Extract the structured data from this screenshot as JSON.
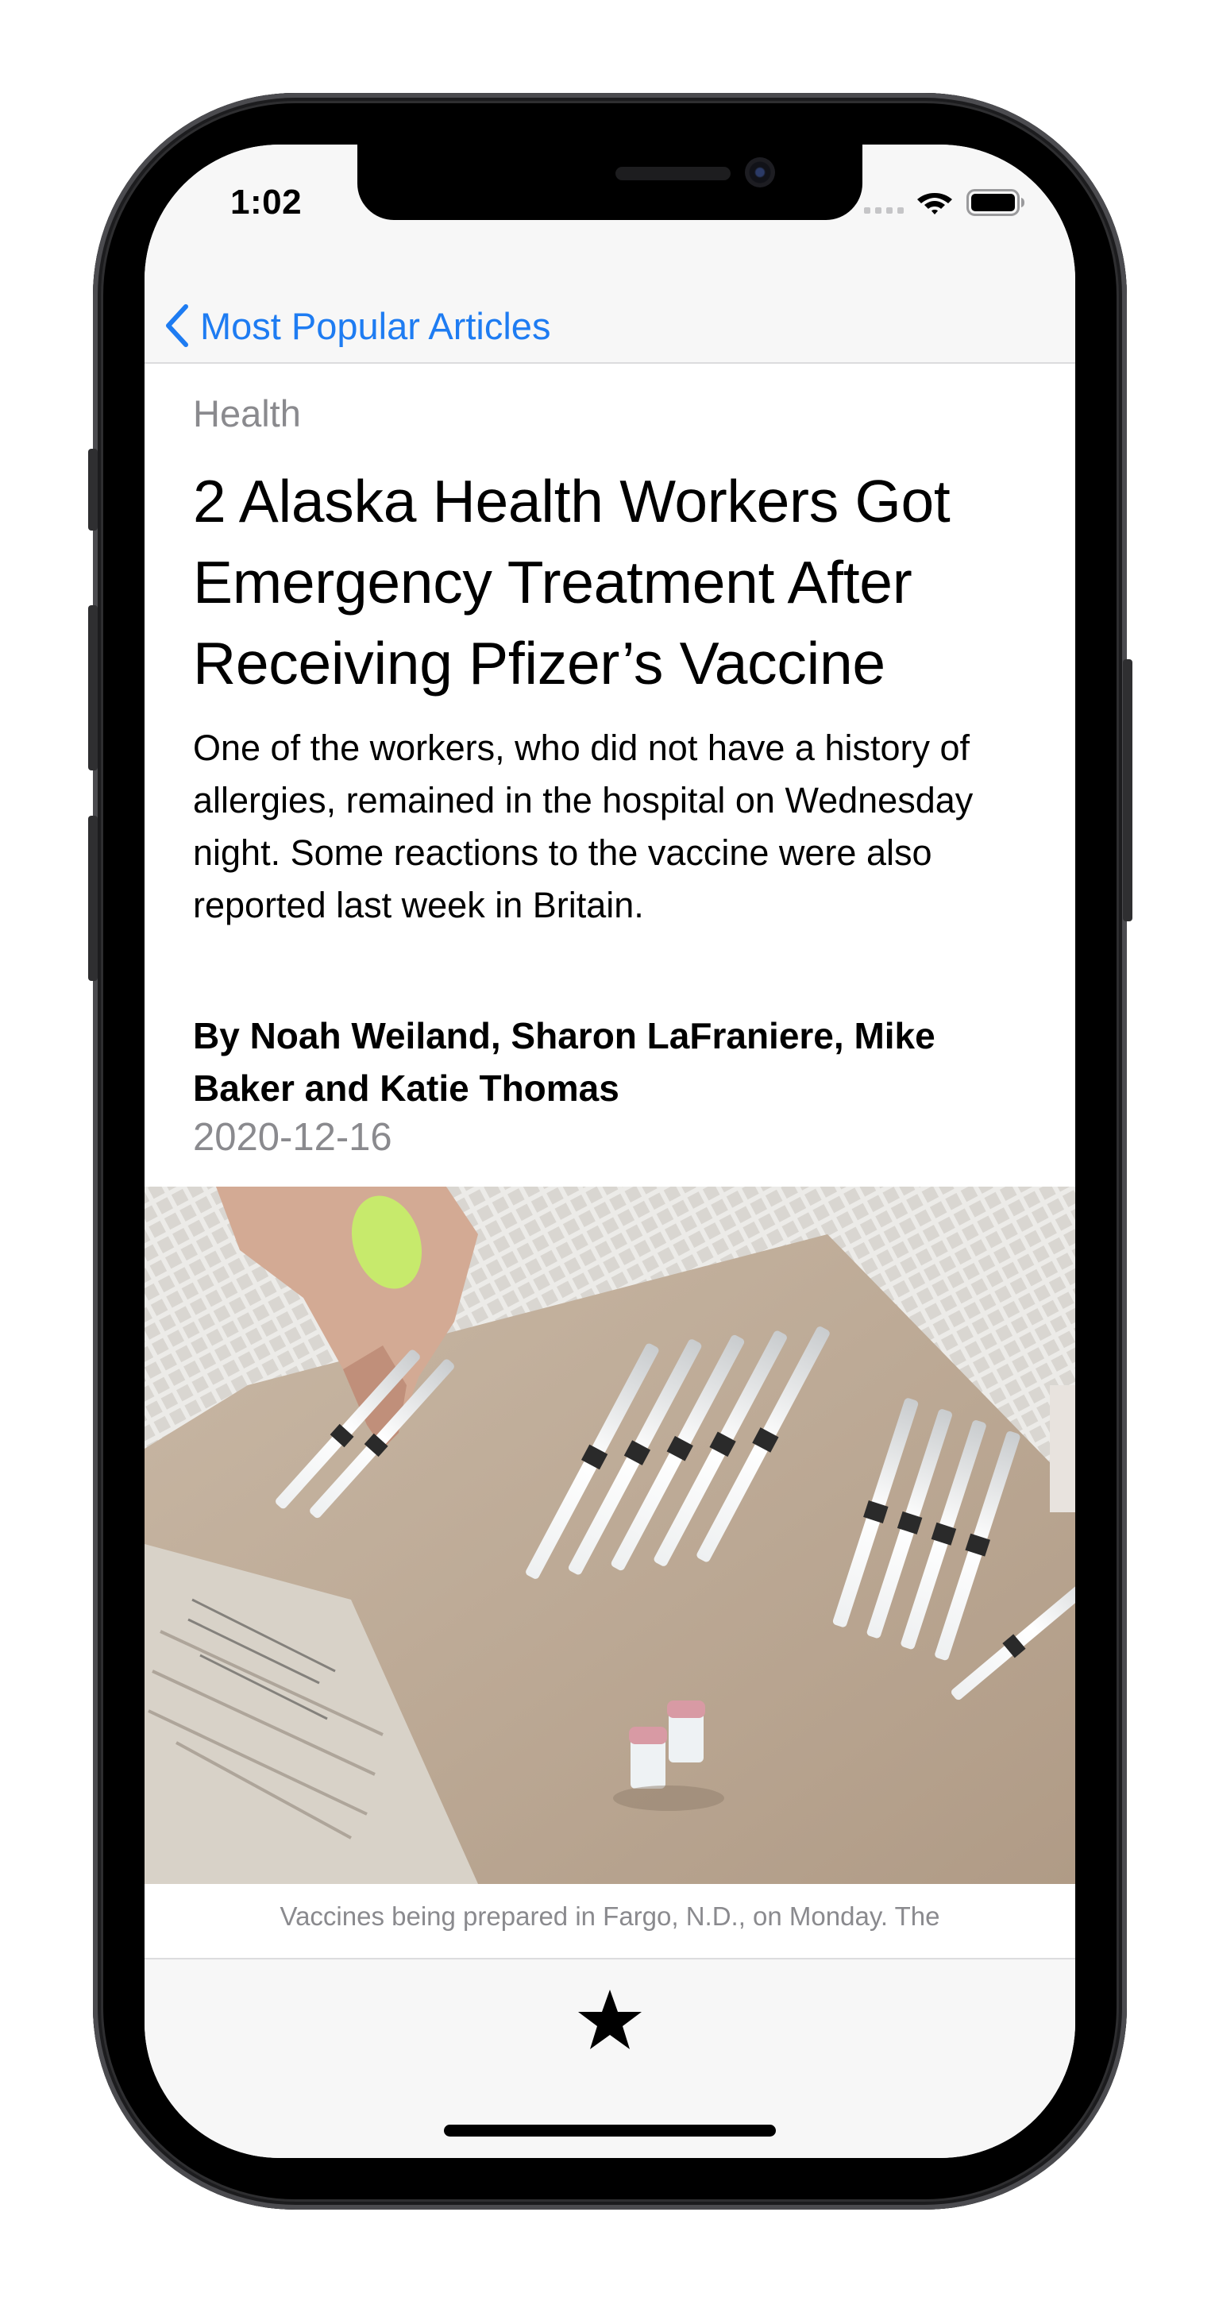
{
  "status_bar": {
    "time": "1:02",
    "signal_icon": "cellular-signal-icon",
    "wifi_icon": "wifi-icon",
    "battery_icon": "battery-icon"
  },
  "nav": {
    "back_icon": "chevron-left-icon",
    "back_label": "Most Popular Articles",
    "accent_color": "#1e7cf2"
  },
  "article": {
    "section": "Health",
    "headline": "2 Alaska Health Workers Got Emergency Treatment After Receiving Pfizer’s Vaccine",
    "abstract": "One of the workers, who did not have a history of allergies, remained in the hospital on Wednesday night. Some reactions to the vaccine were also reported last week in Britain.",
    "byline": "By Noah Weiland, Sharon LaFraniere, Mike Baker and Katie Thomas",
    "date": "2020-12-16",
    "image": "photo of syringes and vaccine vials on a tray",
    "caption": "Vaccines being prepared in Fargo, N.D., on Monday. The"
  },
  "tab_bar": {
    "favorite_icon": "star-icon"
  },
  "colors": {
    "secondary_text": "#8a8a8e",
    "bar_background": "#f7f7f7"
  }
}
